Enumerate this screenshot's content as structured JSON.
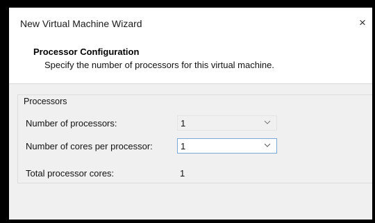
{
  "window": {
    "title": "New Virtual Machine Wizard",
    "close_label": "×"
  },
  "header": {
    "title": "Processor Configuration",
    "subtitle": "Specify the number of processors for this virtual machine."
  },
  "processors": {
    "group_label": "Processors",
    "num_processors_label": "Number of processors:",
    "num_processors_value": "1",
    "cores_per_processor_label": "Number of cores per processor:",
    "cores_per_processor_value": "1",
    "total_cores_label": "Total processor cores:",
    "total_cores_value": "1"
  },
  "icons": {
    "close": "close-icon",
    "dropdown": "chevron-down-icon"
  }
}
